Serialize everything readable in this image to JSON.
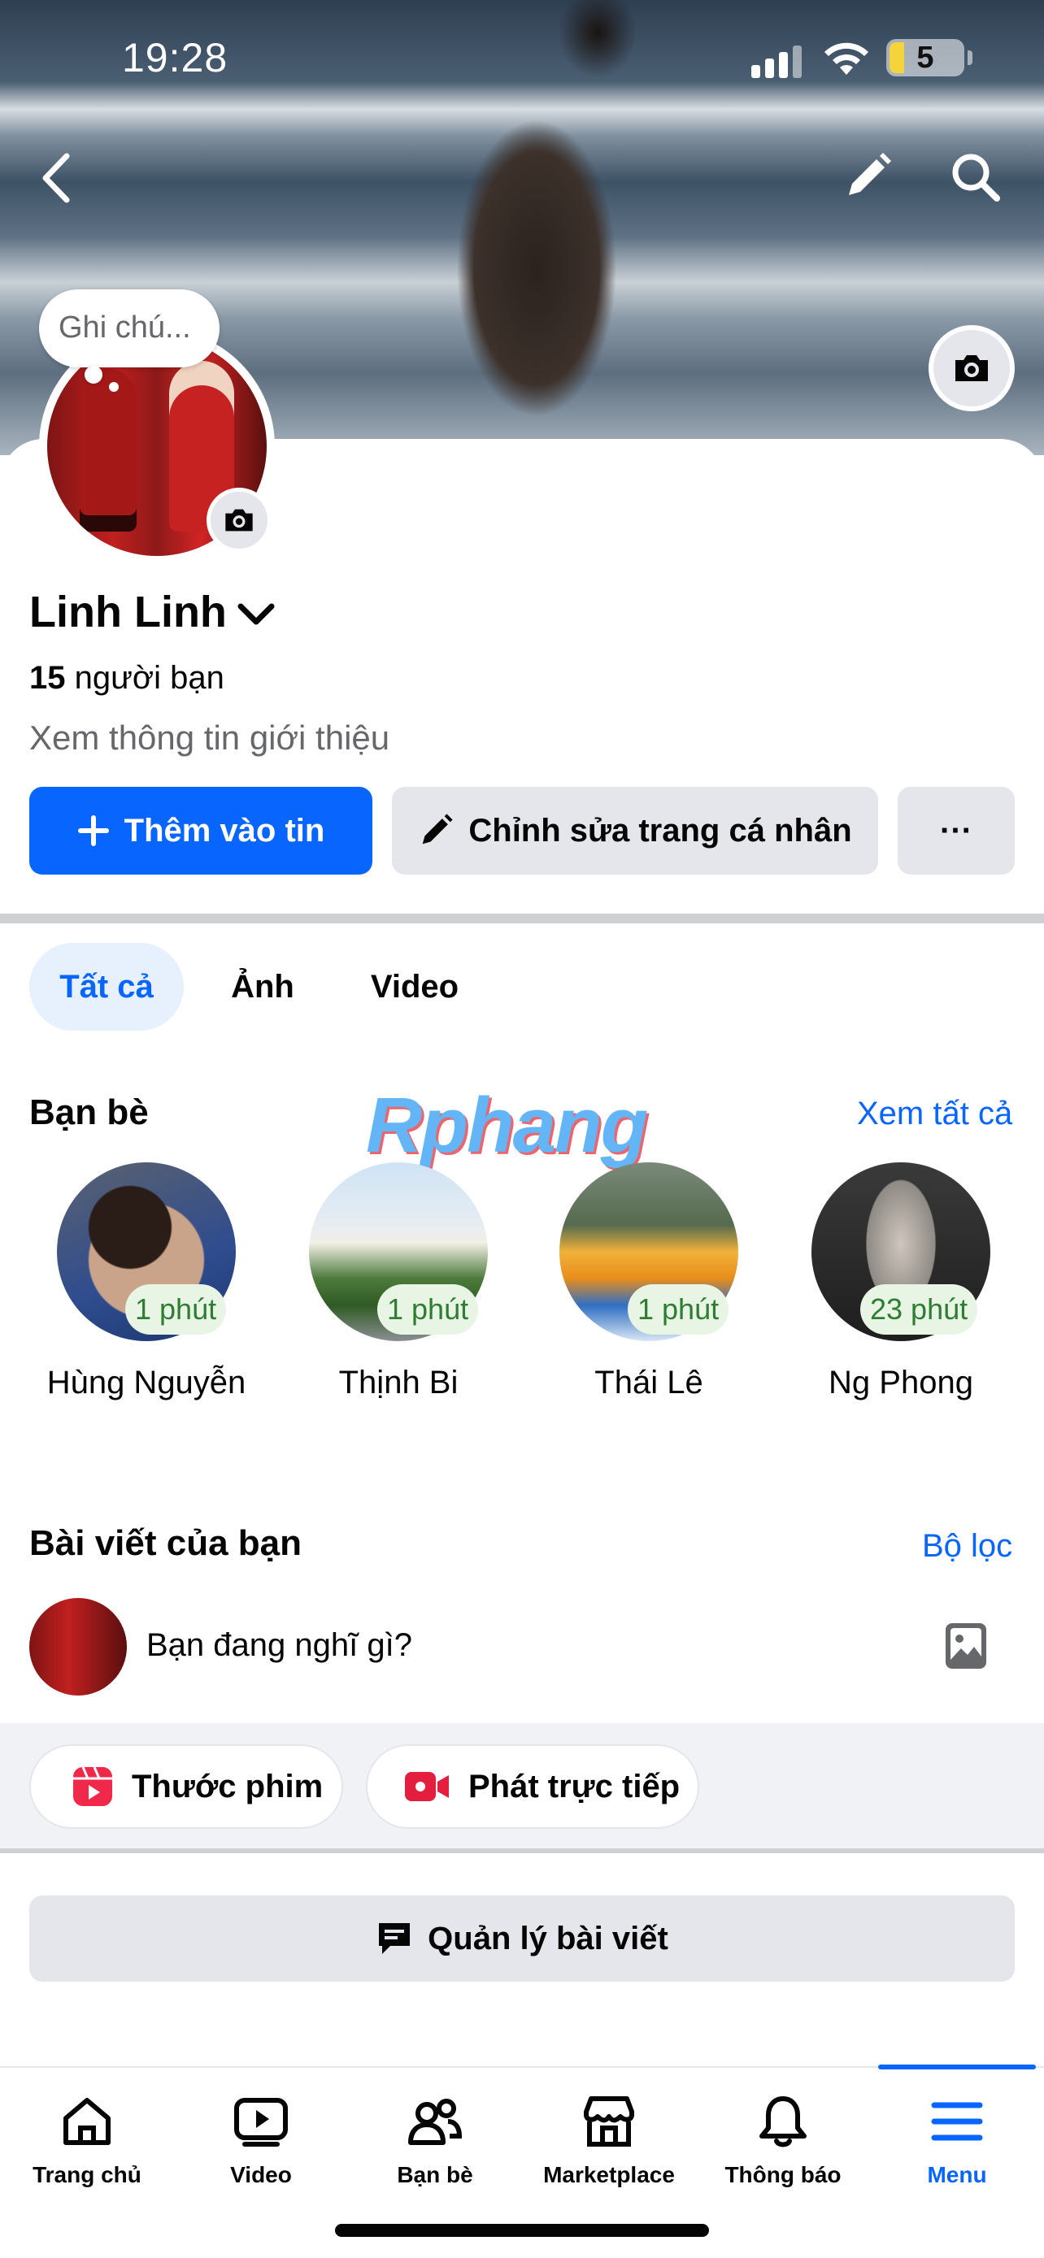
{
  "status_bar": {
    "time": "19:28",
    "battery_level": "5"
  },
  "note": {
    "placeholder": "Ghi chú..."
  },
  "profile": {
    "name": "Linh Linh",
    "friends_count": "15",
    "friends_suffix": " người bạn",
    "intro_link": "Xem thông tin giới thiệu"
  },
  "actions": {
    "add_story": "Thêm vào tin",
    "edit_profile": "Chỉnh sửa trang cá nhân",
    "more": "···"
  },
  "tabs": [
    {
      "label": "Tất cả",
      "active": true
    },
    {
      "label": "Ảnh",
      "active": false
    },
    {
      "label": "Video",
      "active": false
    }
  ],
  "watermark": "Rphang",
  "friends_section": {
    "title": "Bạn bè",
    "see_all": "Xem tất cả",
    "friends": [
      {
        "name": "Hùng Nguyễn",
        "active": "1 phút"
      },
      {
        "name": "Thịnh Bi",
        "active": "1 phút"
      },
      {
        "name": "Thái Lê",
        "active": "1 phút"
      },
      {
        "name": "Ng Phong",
        "active": "23 phút"
      }
    ]
  },
  "posts_section": {
    "title": "Bài viết của bạn",
    "filter": "Bộ lọc",
    "composer_prompt": "Bạn đang nghĩ gì?",
    "reels_label": "Thước phim",
    "live_label": "Phát trực tiếp",
    "manage_posts": "Quản lý bài viết"
  },
  "bottom_nav": [
    {
      "label": "Trang chủ",
      "icon": "home-icon",
      "active": false
    },
    {
      "label": "Video",
      "icon": "video-icon",
      "active": false
    },
    {
      "label": "Bạn bè",
      "icon": "friends-icon",
      "active": false
    },
    {
      "label": "Marketplace",
      "icon": "marketplace-icon",
      "active": false
    },
    {
      "label": "Thông báo",
      "icon": "bell-icon",
      "active": false
    },
    {
      "label": "Menu",
      "icon": "menu-icon",
      "active": true
    }
  ],
  "colors": {
    "primary": "#0866ff",
    "secondary_button": "#e4e6eb",
    "text_secondary": "#65676b",
    "active_badge_bg": "#e8f5e4",
    "active_badge_text": "#2e7d32",
    "reels_icon": "#f02849",
    "live_icon": "#e41e3f"
  }
}
